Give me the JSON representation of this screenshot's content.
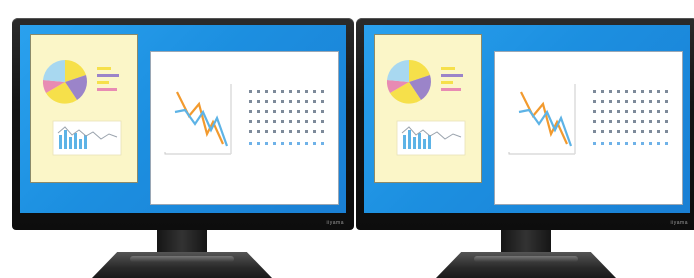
{
  "monitors": [
    {
      "brand": "iiyama"
    },
    {
      "brand": "iiyama"
    }
  ],
  "colors": {
    "screen": "#1c8fe0",
    "bezel": "#151515",
    "window_left_bg": "#fbf6c8",
    "window_right_bg": "#ffffff",
    "pie_blue": "#a8d8f0",
    "pie_yellow": "#f6e04a",
    "pie_purple": "#9b84c9",
    "pie_pink": "#e88bb3",
    "line_orange": "#f29a2e",
    "line_blue": "#5db3e6",
    "dot_grey": "#7d8a9a",
    "dot_blue": "#6fb2e8"
  },
  "icons": [
    "pie-chart-icon",
    "bar-line-chart-icon",
    "line-chart-icon",
    "dot-grid-icon"
  ]
}
